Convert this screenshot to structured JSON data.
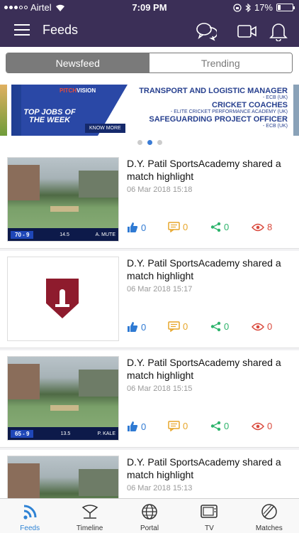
{
  "status": {
    "carrier": "Airtel",
    "time": "7:09 PM",
    "battery": "17%"
  },
  "header": {
    "title": "Feeds",
    "icons": [
      "menu-icon",
      "chat-icon",
      "video-icon",
      "bell-icon"
    ]
  },
  "segments": {
    "newsfeed": "Newsfeed",
    "trending": "Trending"
  },
  "banner": {
    "logo_a": "PITCH",
    "logo_b": "VISION",
    "left_text": "TOP JOBS OF THE WEEK",
    "button": "KNOW MORE",
    "line1": "TRANSPORT AND LOGISTIC MANAGER",
    "line1_sub": "- ECB (UK)",
    "line2": "CRICKET COACHES",
    "line2_sub": "- ELITE CRICKET PERFORMANCE ACADEMY (UK)",
    "line3": "SAFEGUARDING PROJECT OFFICER",
    "line3_sub": "- ECB (UK)",
    "pages": 3,
    "active_page": 2
  },
  "feed": [
    {
      "title": "D.Y. Patil SportsAcademy shared a match highlight",
      "date": "06 Mar 2018 15:18",
      "thumb": "match",
      "score": "70 - 9",
      "overs": "14.5",
      "batsman": "A. MUTE",
      "likes": "0",
      "comments": "0",
      "shares": "0",
      "views": "8"
    },
    {
      "title": "D.Y. Patil SportsAcademy shared a match highlight",
      "date": "06 Mar 2018 15:17",
      "thumb": "logo",
      "likes": "0",
      "comments": "0",
      "shares": "0",
      "views": "0"
    },
    {
      "title": "D.Y. Patil SportsAcademy shared a match highlight",
      "date": "06 Mar 2018 15:15",
      "thumb": "match",
      "score": "65 - 9",
      "overs": "13.5",
      "batsman": "P. KALE",
      "likes": "0",
      "comments": "0",
      "shares": "0",
      "views": "0"
    },
    {
      "title": "D.Y. Patil SportsAcademy shared a match highlight",
      "date": "06 Mar 2018 15:13",
      "thumb": "match",
      "score": "",
      "overs": "",
      "batsman": "",
      "likes": "0",
      "comments": "0",
      "shares": "0",
      "views": "0"
    }
  ],
  "tabs": [
    {
      "label": "Feeds",
      "icon": "rss-icon",
      "active": true
    },
    {
      "label": "Timeline",
      "icon": "timeline-icon",
      "active": false
    },
    {
      "label": "Portal",
      "icon": "globe-icon",
      "active": false
    },
    {
      "label": "TV",
      "icon": "tv-icon",
      "active": false
    },
    {
      "label": "Matches",
      "icon": "ball-icon",
      "active": false
    }
  ],
  "colors": {
    "header": "#3b2f57",
    "like": "#2f7ad3",
    "comment": "#e7a62a",
    "share": "#2db36b",
    "view": "#d9483b",
    "tab_active": "#2f83d4"
  }
}
